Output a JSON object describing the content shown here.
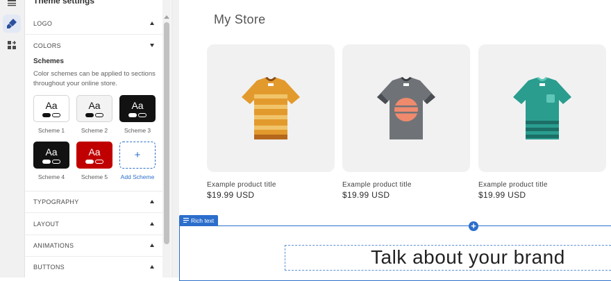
{
  "rail": {
    "icons": [
      "sections-icon",
      "theme-settings-icon",
      "app-blocks-icon"
    ]
  },
  "panel": {
    "title": "Theme settings",
    "sections": {
      "logo": "LOGO",
      "colors": "COLORS",
      "typography": "TYPOGRAPHY",
      "layout": "LAYOUT",
      "animations": "ANIMATIONS",
      "buttons": "BUTTONS"
    },
    "schemes_title": "Schemes",
    "schemes_desc": "Color schemes can be applied to sections throughout your online store.",
    "schemes": [
      {
        "label": "Scheme 1",
        "sample": "Aa",
        "bg": "#ffffff",
        "fg": "#121212"
      },
      {
        "label": "Scheme 2",
        "sample": "Aa",
        "bg": "#f3f3f3",
        "fg": "#121212"
      },
      {
        "label": "Scheme 3",
        "sample": "Aa",
        "bg": "#121212",
        "fg": "#ffffff"
      },
      {
        "label": "Scheme 4",
        "sample": "Aa",
        "bg": "#121212",
        "fg": "#ffffff"
      },
      {
        "label": "Scheme 5",
        "sample": "Aa",
        "bg": "#c00000",
        "fg": "#ffffff"
      }
    ],
    "add_scheme_label": "Add Scheme",
    "add_scheme_icon": "+"
  },
  "preview": {
    "store_title": "My Store",
    "products": [
      {
        "title": "Example product title",
        "price": "$19.99 USD",
        "shirt": "orange-striped-shirt"
      },
      {
        "title": "Example product title",
        "price": "$19.99 USD",
        "shirt": "gray-sunset-shirt"
      },
      {
        "title": "Example product title",
        "price": "$19.99 USD",
        "shirt": "teal-pocket-shirt"
      }
    ],
    "section_tag": "Rich text",
    "rich_text_heading": "Talk about your brand"
  },
  "colors": {
    "accent": "#2c6ecb"
  }
}
